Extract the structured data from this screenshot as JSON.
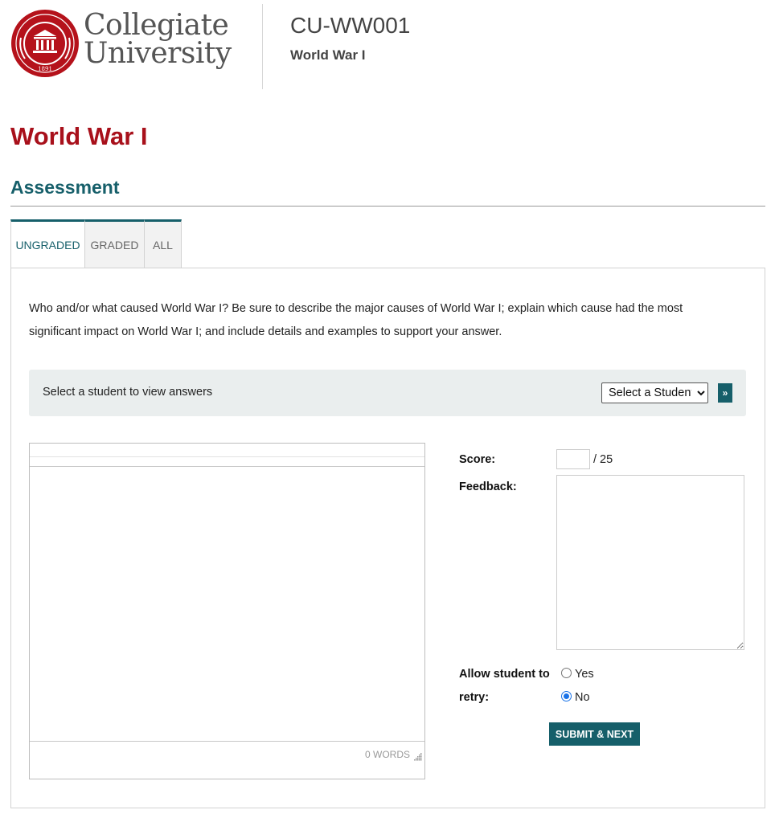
{
  "header": {
    "logo": {
      "seal_text": "LOREM IPSUM DOLOR",
      "year": "1891",
      "line1": "Collegiate",
      "line2": "University"
    },
    "course_code": "CU-WW001",
    "course_name": "World War I"
  },
  "page_title": "World War I",
  "section_title": "Assessment",
  "tabs": [
    {
      "label": "UNGRADED",
      "active": true
    },
    {
      "label": "GRADED",
      "active": false
    },
    {
      "label": "ALL",
      "active": false
    }
  ],
  "question": "Who and/or what caused World War I? Be sure to describe the major causes of World War I; explain which cause had the most significant impact on World War I; and include details and examples to support your answer.",
  "student_bar": {
    "label": "Select a student to view answers",
    "select_value": "Select a Student",
    "go_label": "»"
  },
  "editor": {
    "word_count": "0 WORDS"
  },
  "grading": {
    "score_label": "Score:",
    "score_value": "",
    "score_max": "/ 25",
    "feedback_label": "Feedback:",
    "retry_label_line1": "Allow student to",
    "retry_label_line2": "retry:",
    "options": [
      {
        "label": "Yes",
        "checked": false
      },
      {
        "label": "No",
        "checked": true
      }
    ],
    "submit_label": "SUBMIT & NEXT"
  },
  "colors": {
    "brand_red": "#a8101b",
    "accent_teal": "#165f6a",
    "radio_blue": "#1a73e8"
  }
}
